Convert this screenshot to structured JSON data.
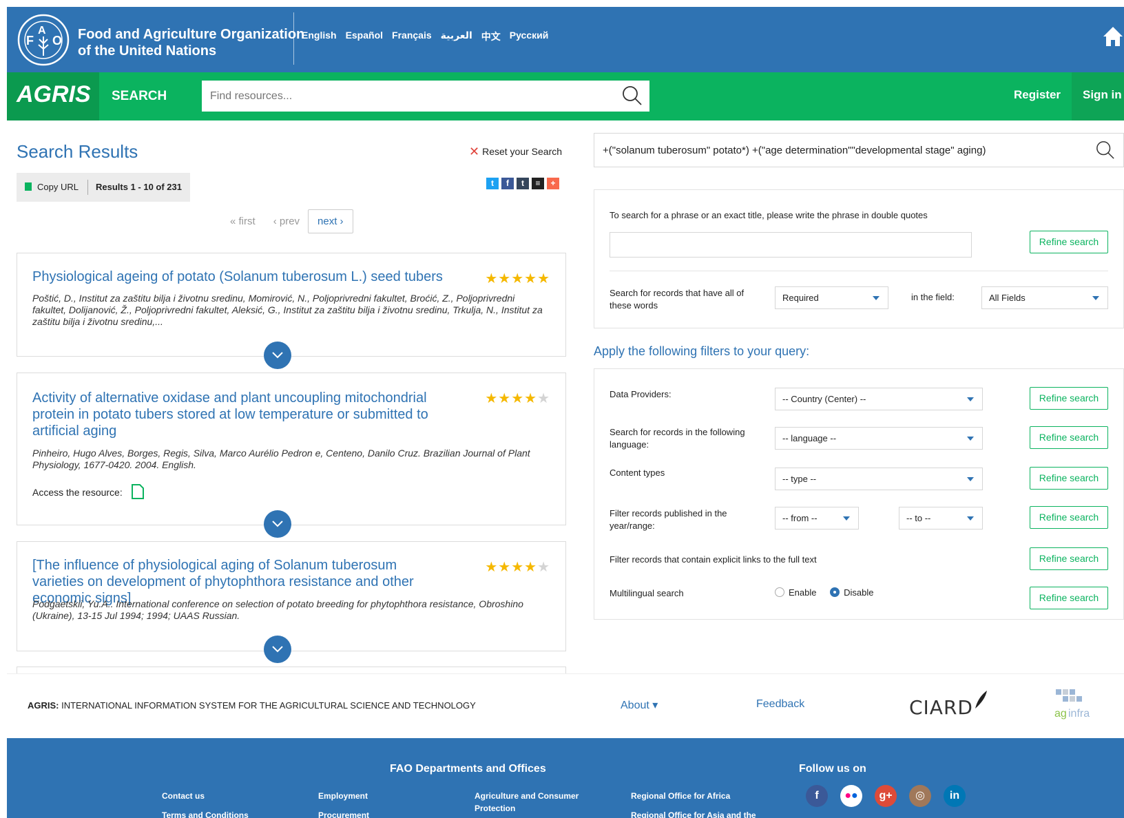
{
  "fao": {
    "name_line1": "Food and Agriculture Organization",
    "name_line2": "of the United Nations",
    "languages": [
      "English",
      "Español",
      "Français",
      "العربية",
      "中文",
      "Русский"
    ]
  },
  "agris": {
    "logo": "AGRIS",
    "search_tab": "SEARCH",
    "search_placeholder": "Find resources...",
    "register": "Register",
    "signin": "Sign in"
  },
  "results": {
    "title": "Search Results",
    "reset": "Reset your Search",
    "copy_url": "Copy URL",
    "count": "Results 1 - 10 of 231",
    "pager": {
      "first": "« first",
      "prev": "‹ prev",
      "next": "next ›"
    },
    "items": [
      {
        "title": "Physiological ageing of potato (Solanum tuberosum L.) seed tubers",
        "rating": 5,
        "authors": "Poštić, D., Institut za zaštitu bilja i životnu sredinu, Momirović, N., Poljoprivredni fakultet, Broćić, Z., Poljoprivredni fakultet, Dolijanović, Ž., Poljoprivredni fakultet, Aleksić, G., Institut za zaštitu bilja i životnu sredinu, Trkulja, N., Institut za zaštitu bilja i životnu sredinu,..."
      },
      {
        "title": "Activity of alternative oxidase and plant uncoupling mitochondrial protein in potato tubers stored at low temperature or submitted to artificial aging",
        "rating": 4,
        "authors": "Pinheiro, Hugo Alves, Borges, Regis, Silva, Marco Aurélio Pedron e, Centeno, Danilo Cruz. Brazilian Journal of Plant Physiology, 1677-0420. 2004. English.",
        "access": "Access the resource:"
      },
      {
        "title": "[The influence of physiological aging of Solanum tuberosum varieties on development of phytophthora resistance and other economic signs]",
        "rating": 4,
        "authors": "Podgaetskii, Yu.A.. International conference on selection of potato breeding for phytophthora resistance, Obroshino (Ukraine), 13-15 Jul 1994; 1994; UAAS Russian."
      }
    ]
  },
  "query": {
    "value": "+(\"solanum tuberosum\" potato*) +(\"age determination\"\"developmental stage\" aging)"
  },
  "advanced": {
    "phrase_hint": "To search for a phrase or an exact title, please write the phrase in double quotes",
    "refine_label": "Refine search",
    "records_label": "Search for records that have all of these words",
    "required": "Required",
    "in_field": "in the field:",
    "all_fields": "All Fields",
    "filters_title": "Apply the following filters to your query:",
    "data_providers": "Data Providers:",
    "country": "-- Country (Center) --",
    "lang_label": "Search for records in the following language:",
    "language": "-- language --",
    "content_types": "Content types",
    "type": "-- type --",
    "year_label": "Filter records published in the year/range:",
    "from": "-- from --",
    "to": "-- to --",
    "fulltext_label": "Filter records that contain explicit links to the full text",
    "multilingual": "Multilingual search",
    "enable": "Enable",
    "disable": "Disable"
  },
  "footer": {
    "agris_bold": "AGRIS:",
    "agris_desc": " INTERNATIONAL INFORMATION SYSTEM FOR THE AGRICULTURAL SCIENCE AND TECHNOLOGY",
    "about": "About ▾",
    "feedback": "Feedback",
    "ciard": "CIARD",
    "dept_title": "FAO Departments and Offices",
    "follow": "Follow us on",
    "links": {
      "contact": "Contact us",
      "terms": "Terms and Conditions",
      "employment": "Employment",
      "procurement": "Procurement",
      "agri_consumer": "Agriculture and Consumer Protection",
      "ro_africa": "Regional Office for Africa",
      "ro_asia": "Regional Office for Asia and the"
    }
  },
  "colors": {
    "fao_blue": "#2f73b3",
    "agris_green": "#0bb35f",
    "star": "#f5b800"
  }
}
